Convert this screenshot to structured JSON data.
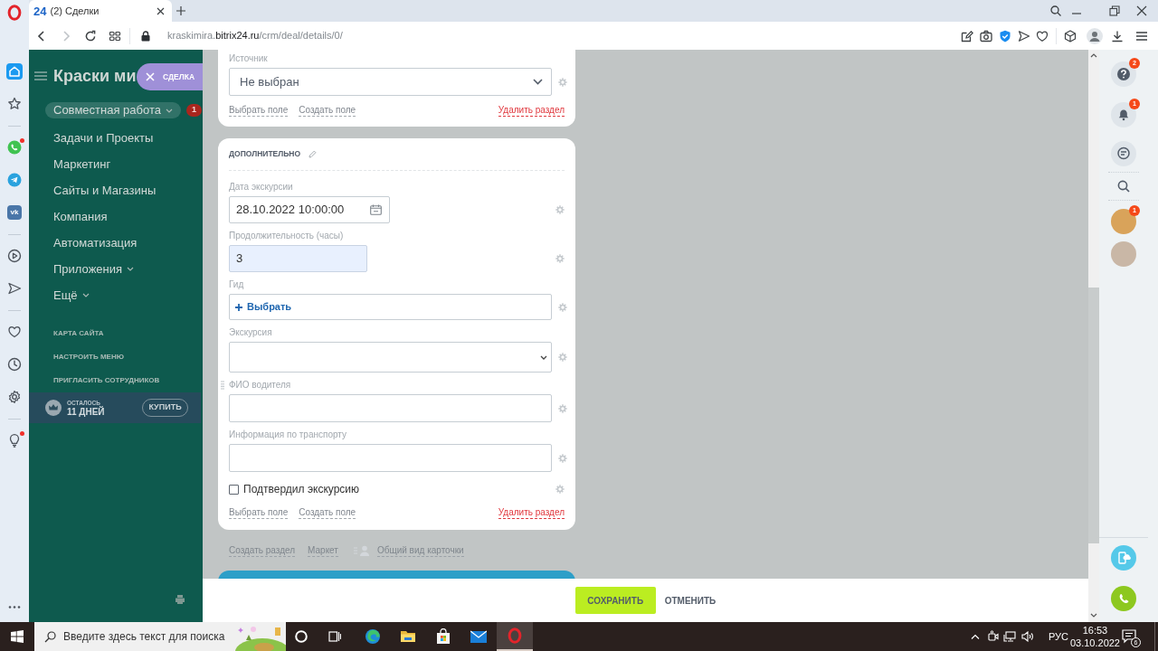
{
  "browser": {
    "tab": {
      "icon_text": "24",
      "title": "(2) Сделки"
    },
    "nav": {
      "back_disabled": false,
      "forward_disabled": true
    },
    "address": {
      "subdomain": "kraskimira.",
      "domain": "bitrix24.ru",
      "path": "/crm/deal/details/0/"
    }
  },
  "opera_sidebar": {
    "groups": [
      [
        {
          "kind": "home",
          "selected": true,
          "dot": false
        },
        {
          "kind": "star",
          "selected": false,
          "dot": false
        }
      ],
      [
        {
          "kind": "whatsapp",
          "selected": false,
          "dot": true
        },
        {
          "kind": "telegram",
          "selected": false,
          "dot": false
        },
        {
          "kind": "vk",
          "label": "vk",
          "selected": false,
          "dot": false
        }
      ],
      [
        {
          "kind": "player",
          "selected": false,
          "dot": false
        },
        {
          "kind": "send",
          "selected": false,
          "dot": false
        }
      ],
      [
        {
          "kind": "heart",
          "selected": false,
          "dot": false
        },
        {
          "kind": "history",
          "selected": false,
          "dot": false
        },
        {
          "kind": "settings",
          "selected": false,
          "dot": false
        }
      ],
      [
        {
          "kind": "bulb",
          "selected": false,
          "dot": true
        }
      ]
    ]
  },
  "menu": {
    "title": "Краски ми",
    "items": [
      {
        "label": "Совместная работа",
        "selected": true,
        "expandable": true,
        "counter": "1"
      },
      {
        "label": "Задачи и Проекты",
        "selected": false,
        "expandable": false
      },
      {
        "label": "Маркетинг",
        "selected": false,
        "expandable": false
      },
      {
        "label": "Сайты и Магазины",
        "selected": false,
        "expandable": false
      },
      {
        "label": "Компания",
        "selected": false,
        "expandable": false
      },
      {
        "label": "Автоматизация",
        "selected": false,
        "expandable": false
      },
      {
        "label": "Приложения",
        "selected": false,
        "expandable": true
      },
      {
        "label": "Ещё",
        "selected": false,
        "expandable": true
      }
    ],
    "links": [
      "КАРТА САЙТА",
      "НАСТРОИТЬ МЕНЮ",
      "ПРИГЛАСИТЬ СОТРУДНИКОВ"
    ],
    "license": {
      "caption": "ОСТАЛОСЬ",
      "days": "11 ДНЕЙ",
      "button": "КУПИТЬ"
    }
  },
  "slider_tab": {
    "label": "СДЕЛКА"
  },
  "form": {
    "sections": [
      {
        "fields": [
          {
            "kind": "select",
            "label": "Источник",
            "value": "Не выбран",
            "highlighted": false,
            "hovered": false
          }
        ],
        "links": {
          "select_field": "Выбрать поле",
          "create_field": "Создать поле",
          "delete_section": "Удалить раздел"
        }
      },
      {
        "title": "ДОПОЛНИТЕЛЬНО",
        "fields": [
          {
            "kind": "datetime",
            "label": "Дата экскурсии",
            "value": "28.10.2022 10:00:00",
            "highlighted": false,
            "hovered": false
          },
          {
            "kind": "number",
            "label": "Продолжительность (часы)",
            "value": "3",
            "highlighted": true,
            "hovered": false
          },
          {
            "kind": "picker",
            "label": "Гид",
            "action": "Выбрать",
            "highlighted": false,
            "hovered": false
          },
          {
            "kind": "list",
            "label": "Экскурсия",
            "highlighted": false,
            "hovered": false
          },
          {
            "kind": "text",
            "label": "ФИО водителя",
            "highlighted": false,
            "hovered": true
          },
          {
            "kind": "text",
            "label": "Информация по транспорту",
            "highlighted": false,
            "hovered": false
          },
          {
            "kind": "checkbox",
            "label": "Подтвердил экскурсию",
            "checked": false,
            "highlighted": false,
            "hovered": false
          }
        ],
        "links": {
          "select_field": "Выбрать поле",
          "create_field": "Создать поле",
          "delete_section": "Удалить раздел"
        }
      }
    ]
  },
  "footer_links": {
    "create_section": "Создать раздел",
    "market": "Маркет",
    "card_view": "Общий вид карточки"
  },
  "actions": {
    "save": "СОХРАНИТЬ",
    "cancel": "ОТМЕНИТЬ"
  },
  "right_panel": {
    "tools": [
      {
        "kind": "help",
        "counter": "2"
      },
      {
        "kind": "notifications",
        "counter": "1"
      },
      {
        "kind": "chat"
      },
      {
        "kind": "search"
      }
    ],
    "recent": [
      {
        "kind": "avatar",
        "counter": "1"
      },
      {
        "kind": "avatar"
      }
    ],
    "actions": [
      {
        "kind": "phone_cloud"
      },
      {
        "kind": "call"
      }
    ]
  },
  "taskbar": {
    "search_placeholder": "Введите здесь текст для поиска",
    "apps": [
      {
        "kind": "cortana",
        "selected": false
      },
      {
        "kind": "task_view",
        "selected": false
      },
      {
        "kind": "edge",
        "selected": false
      },
      {
        "kind": "explorer",
        "selected": false
      },
      {
        "kind": "store",
        "selected": false
      },
      {
        "kind": "mail",
        "selected": false
      },
      {
        "kind": "opera",
        "selected": true
      }
    ],
    "tray": {
      "language": "РУС",
      "time": "16:53",
      "date": "03.10.2022",
      "notifications": "6"
    }
  }
}
